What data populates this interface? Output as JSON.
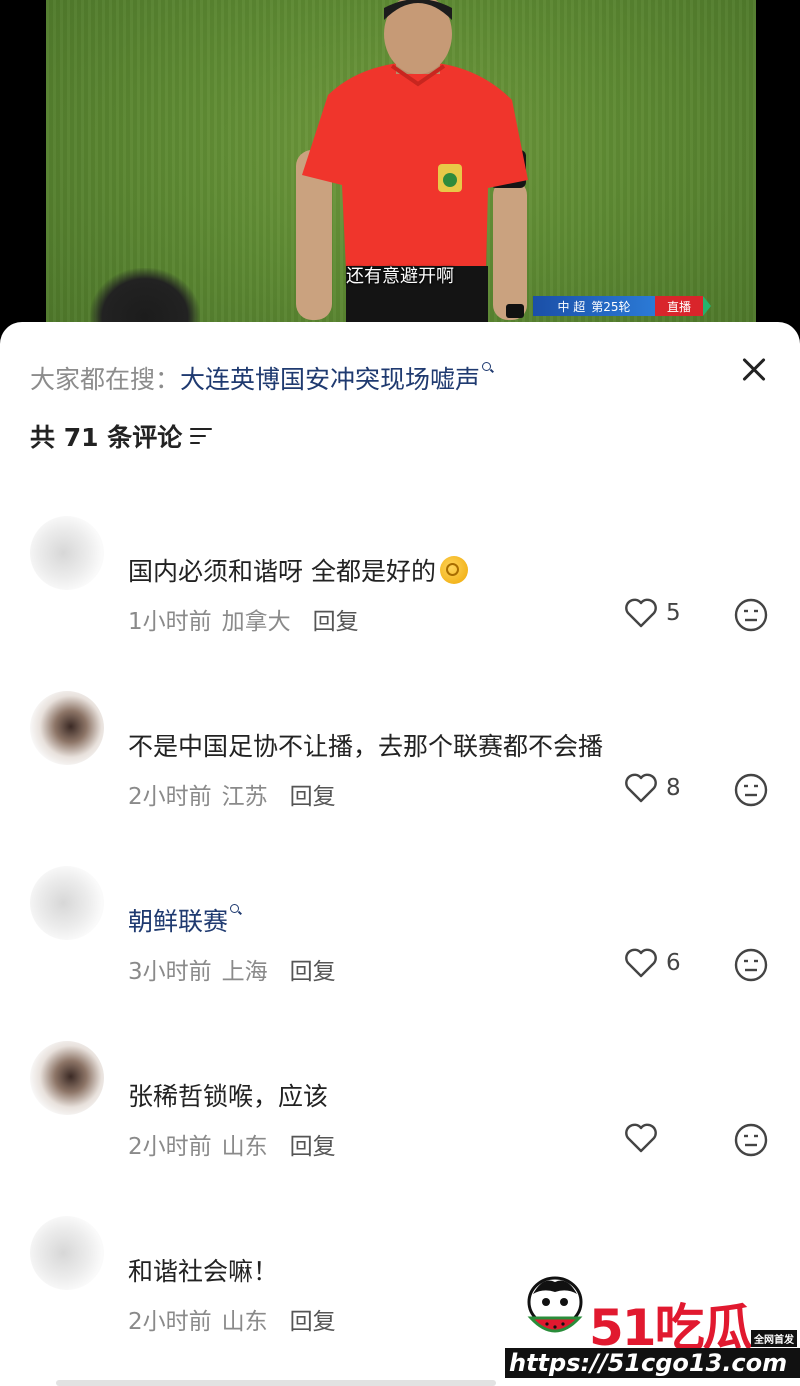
{
  "video": {
    "subtitle": "还有意避开啊",
    "score_bug": {
      "league": "中 超",
      "round": "第25轮",
      "live": "直播"
    }
  },
  "sheet": {
    "hot_search_prefix": "大家都在搜：",
    "hot_search_query": "大连英博国安冲突现场嘘声",
    "comment_count_label": "共 71 条评论",
    "close_icon": "close-icon",
    "filter_icon": "filter-icon"
  },
  "comments": [
    {
      "username": "",
      "text": "国内必须和谐呀 全都是好的",
      "emoji": "ok-hand-emoji",
      "time": "1小时前",
      "location": "加拿大",
      "reply": "回复",
      "likes": "5"
    },
    {
      "username": "",
      "text": "不是中国足协不让播，去那个联赛都不会播",
      "time": "2小时前",
      "location": "江苏",
      "reply": "回复",
      "likes": "8"
    },
    {
      "username": "",
      "text": "朝鲜联赛",
      "is_link": true,
      "time": "3小时前",
      "location": "上海",
      "reply": "回复",
      "likes": "6"
    },
    {
      "username": "",
      "text": "张稀哲锁喉，应该",
      "time": "2小时前",
      "location": "山东",
      "reply": "回复",
      "likes": ""
    },
    {
      "username": "",
      "text": "和谐社会嘛！",
      "time": "2小时前",
      "location": "山东",
      "reply": "回复",
      "likes": ""
    }
  ],
  "watermark": {
    "logo": "51吃瓜",
    "badge": "全网首发",
    "url": "https://51cgo13.com"
  },
  "colors": {
    "link": "#1f3a70",
    "meta_gray": "#8a8a8a",
    "referee_shirt": "#f0352c",
    "live_red": "#d9252b"
  }
}
